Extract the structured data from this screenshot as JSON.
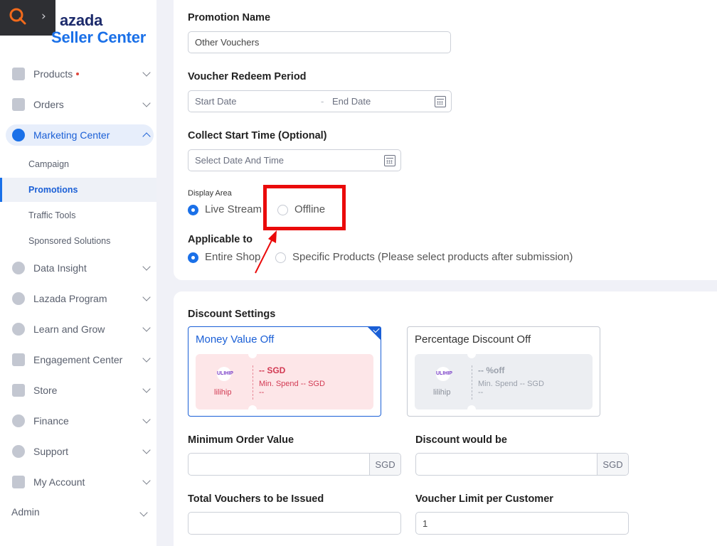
{
  "brand": {
    "line1": "azada",
    "line2": "Seller Center"
  },
  "sidebar": {
    "items": [
      {
        "label": "Products"
      },
      {
        "label": "Orders"
      },
      {
        "label": "Marketing Center"
      },
      {
        "label": "Data Insight"
      },
      {
        "label": "Lazada Program"
      },
      {
        "label": "Learn and Grow"
      },
      {
        "label": "Engagement Center"
      },
      {
        "label": "Store"
      },
      {
        "label": "Finance"
      },
      {
        "label": "Support"
      },
      {
        "label": "My Account"
      }
    ],
    "sub_items": [
      {
        "label": "Campaign"
      },
      {
        "label": "Promotions"
      },
      {
        "label": "Traffic Tools"
      },
      {
        "label": "Sponsored Solutions"
      }
    ],
    "admin": "Admin"
  },
  "form": {
    "promotion_name_label": "Promotion Name",
    "promotion_name_value": "Other Vouchers",
    "redeem_period_label": "Voucher Redeem Period",
    "start_date_placeholder": "Start Date",
    "date_separator": "-",
    "end_date_placeholder": "End Date",
    "collect_start_label": "Collect Start Time (Optional)",
    "collect_start_placeholder": "Select Date And Time",
    "display_area_label": "Display Area",
    "display_options": [
      {
        "label": "Live Stream",
        "selected": true
      },
      {
        "label": "Offline",
        "selected": false
      }
    ],
    "applicable_label": "Applicable to",
    "applicable_options": [
      {
        "label": "Entire Shop",
        "selected": true
      },
      {
        "label": "Specific Products (Please select products after submission)",
        "selected": false
      }
    ]
  },
  "discount": {
    "section_label": "Discount Settings",
    "options": [
      {
        "title": "Money Value Off",
        "selected": true,
        "logo": "ULIHIP",
        "shop": "lilihip",
        "value": "-- SGD",
        "min_spend": "Min. Spend -- SGD",
        "extra": "--"
      },
      {
        "title": "Percentage Discount Off",
        "selected": false,
        "logo": "ULIHIP",
        "shop": "lilihip",
        "value": "-- %off",
        "min_spend": "Min. Spend -- SGD",
        "extra": "--"
      }
    ],
    "min_order_label": "Minimum Order Value",
    "min_order_value": "",
    "min_order_suffix": "SGD",
    "discount_would_be_label": "Discount would be",
    "discount_would_be_value": "",
    "discount_suffix": "SGD",
    "total_vouchers_label": "Total Vouchers to be Issued",
    "total_vouchers_value": "",
    "limit_per_customer_label": "Voucher Limit per Customer",
    "limit_per_customer_value": "1"
  },
  "colors": {
    "accent": "#1a70e8",
    "highlight": "#ea0a0a",
    "voucher_pink": "#fde6e8"
  }
}
